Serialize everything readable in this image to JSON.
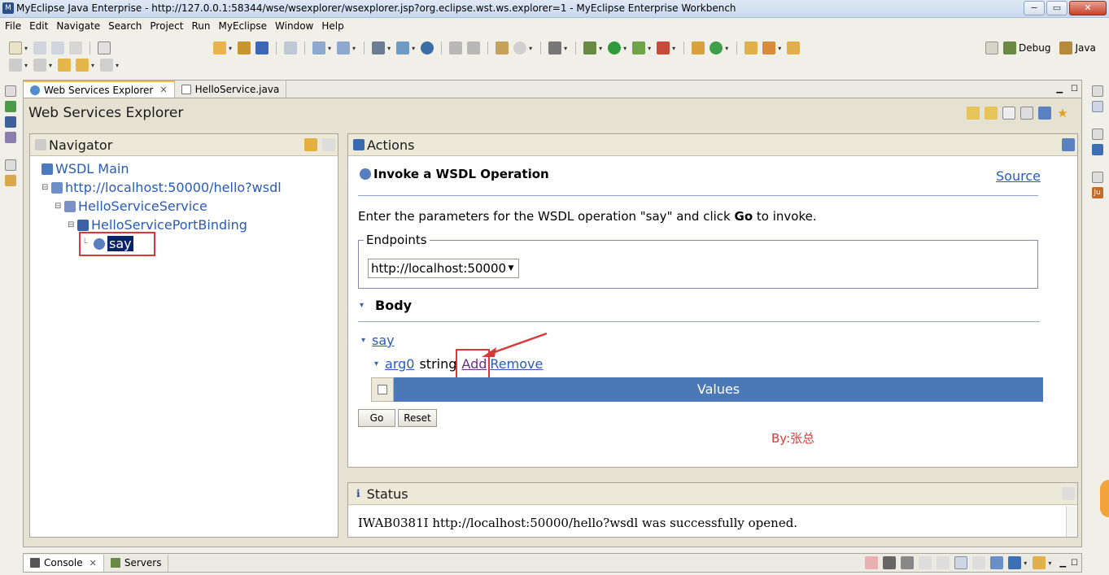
{
  "window": {
    "title": "MyEclipse Java Enterprise - http://127.0.0.1:58344/wse/wsexplorer/wsexplorer.jsp?org.eclipse.wst.ws.explorer=1 - MyEclipse Enterprise Workbench",
    "minimize": "−",
    "maximize": "▭",
    "close": "✕"
  },
  "menu": [
    "File",
    "Edit",
    "Navigate",
    "Search",
    "Project",
    "Run",
    "MyEclipse",
    "Window",
    "Help"
  ],
  "perspectives": {
    "debug": "Debug",
    "java": "Java"
  },
  "editor_tabs": [
    {
      "label": "Web Services Explorer",
      "close": "✕"
    },
    {
      "label": "HelloService.java"
    }
  ],
  "wse": {
    "title": "Web Services Explorer",
    "navigator": {
      "title": "Navigator",
      "tree": [
        {
          "label": "WSDL Main",
          "icon": "wsdl-main-icon"
        },
        {
          "label": "http://localhost:50000/hello?wsdl",
          "icon": "wsdl-icon"
        },
        {
          "label": "HelloServiceService",
          "icon": "service-icon"
        },
        {
          "label": "HelloServicePortBinding",
          "icon": "binding-icon"
        },
        {
          "label": "say",
          "icon": "operation-icon"
        }
      ]
    },
    "actions": {
      "title": "Actions",
      "heading": "Invoke a WSDL Operation",
      "source_link": "Source",
      "instruction_pre": "Enter the parameters for the WSDL operation \"say\" and click ",
      "instruction_bold": "Go",
      "instruction_post": " to invoke.",
      "endpoints_legend": "Endpoints",
      "endpoint_value": "http://localhost:50000",
      "body_label": "Body",
      "say_link": "say",
      "arg_link": "arg0",
      "arg_type": "string",
      "add_link": "Add",
      "remove_link": "Remove",
      "values_header": "Values",
      "go_button": "Go",
      "reset_button": "Reset",
      "watermark": "By:张总"
    },
    "status": {
      "title": "Status",
      "message": "IWAB0381I http://localhost:50000/hello?wsdl was successfully opened."
    }
  },
  "bottom_tabs": [
    {
      "label": "Console",
      "close": "✕"
    },
    {
      "label": "Servers"
    }
  ],
  "colors": {
    "link": "#2a5bb5",
    "values_header_bg": "#4a79b5",
    "highlight_box": "#d63a3a",
    "selected_bg": "#0a246a",
    "watermark": "#d63a3a"
  }
}
